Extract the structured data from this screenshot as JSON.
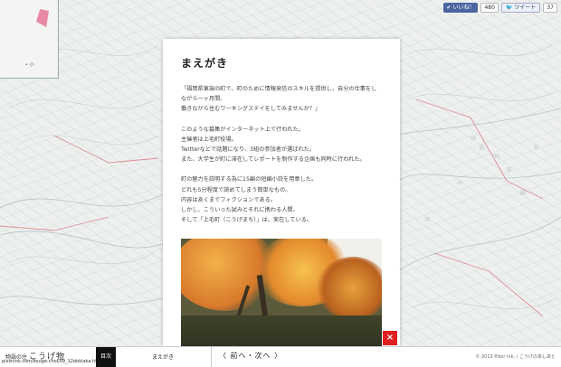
{
  "social": {
    "like_label": "いいね！",
    "like_count": "480",
    "tweet_label": "ツイート",
    "tweet_count": "37"
  },
  "inset_map": {
    "label": "• 小"
  },
  "card": {
    "title": "まえがき",
    "paragraphs": [
      [
        "「福岡県東端の町で、町のために情報発信のスキルを提供し、自分の仕事をし",
        "ながら一ヶ月間、",
        "働きながら住むワーキングステイをしてみませんか？」"
      ],
      [
        "このような募集がインターネット上で行われた。",
        "主催者は上毛町役場。",
        "Twitterなどで話題になり、3組の参加者が選ばれた。",
        "また、大学生が町に滞在してレポートを制作する企画も同時に行われた。"
      ],
      [
        "町の魅力を説明する為に15編の短編小説を用意した。",
        "どれも5分程度で読めてしまう簡単なもの。",
        "内容はあくまでフィクションである。",
        "しかし、こういった試みとそれに携わる人間、",
        "そして「上毛町（こうげまち）」は、実在している。"
      ]
    ]
  },
  "close_label": "×",
  "footer": {
    "brand_small": "物語の住",
    "brand_script": "こうげ物",
    "url": "pixsnink.com/kouge-chol/09_12dokiaka.html",
    "toc_label": "目次",
    "section_label": "まえがき",
    "nav_label": "〈 前へ・次へ 〉",
    "copyright": "© 2013 Pikor Ink. / こうげのあしあと"
  },
  "colors": {
    "close": "#e02020",
    "fb": "#4a66a0",
    "toc_bg": "#111111"
  }
}
